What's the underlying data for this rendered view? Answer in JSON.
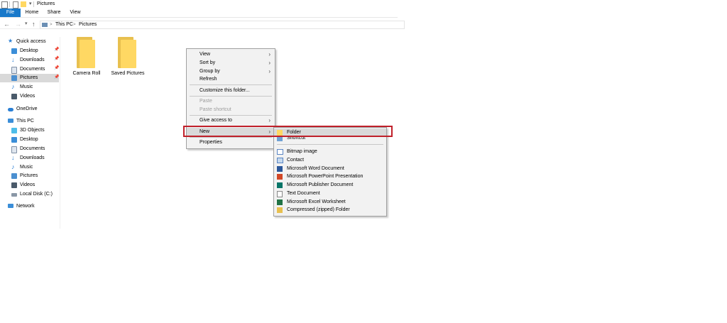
{
  "window": {
    "title": "Pictures"
  },
  "ribbon": {
    "file": "File",
    "home": "Home",
    "share": "Share",
    "view": "View"
  },
  "address": {
    "crumbs": [
      "This PC",
      "Pictures"
    ],
    "sep": ">"
  },
  "sidebar": {
    "quick_access": "Quick access",
    "quick_items": [
      "Desktop",
      "Downloads",
      "Documents",
      "Pictures",
      "Music",
      "Videos"
    ],
    "onedrive": "OneDrive",
    "this_pc": "This PC",
    "pc_items": [
      "3D Objects",
      "Desktop",
      "Documents",
      "Downloads",
      "Music",
      "Pictures",
      "Videos",
      "Local Disk (C:)"
    ],
    "network": "Network"
  },
  "content": {
    "folders": [
      "Camera Roll",
      "Saved Pictures"
    ]
  },
  "context_menu": {
    "view": "View",
    "sort_by": "Sort by",
    "group_by": "Group by",
    "refresh": "Refresh",
    "customize": "Customize this folder...",
    "paste": "Paste",
    "paste_shortcut": "Paste shortcut",
    "give_access": "Give access to",
    "new": "New",
    "properties": "Properties"
  },
  "new_submenu": {
    "folder": "Folder",
    "shortcut": "Shortcut",
    "bitmap": "Bitmap image",
    "contact": "Contact",
    "word": "Microsoft Word Document",
    "powerpoint": "Microsoft PowerPoint Presentation",
    "publisher": "Microsoft Publisher Document",
    "text": "Text Document",
    "excel": "Microsoft Excel Worksheet",
    "zip": "Compressed (zipped) Folder"
  },
  "colors": {
    "accent": "#1979ca",
    "highlight_box": "#c0202a",
    "folder": "#ffd863",
    "menu_bg": "#f2f2f2",
    "selected": "#d9d9d9"
  },
  "icons": [
    "folder-icon",
    "chevron-right-icon",
    "back-arrow-icon",
    "forward-arrow-icon",
    "up-arrow-icon",
    "star-icon",
    "pin-icon",
    "cloud-icon",
    "computer-icon",
    "network-icon"
  ]
}
